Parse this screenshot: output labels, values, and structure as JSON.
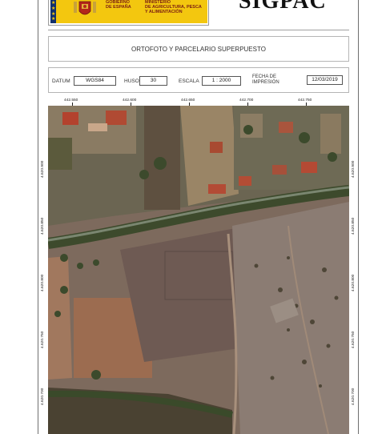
{
  "header": {
    "gov_lines": [
      "GOBIERNO",
      "DE ESPAÑA"
    ],
    "ministry_lines": [
      "MINISTERIO",
      "DE AGRICULTURA, PESCA",
      "Y ALIMENTACIÓN"
    ],
    "app_title": "SIGPAC"
  },
  "map_title": "ORTOFOTO Y PARCELARIO SUPERPUESTO",
  "meta": {
    "datum_label": "DATUM",
    "datum_value": "WGS84",
    "huso_label": "HUSO",
    "huso_value": "30",
    "escala_label": "ESCALA",
    "escala_value": "1 : 2000",
    "fecha_label_1": "FECHA DE",
    "fecha_label_2": "IMPRESIÓN",
    "fecha_value": "12/03/2019"
  },
  "map": {
    "top_ticks": [
      "442.550",
      "442.600",
      "442.650",
      "442.700",
      "442.750"
    ],
    "left_ticks": [
      "4.620.900",
      "4.620.850",
      "4.620.800",
      "4.620.750",
      "4.620.700"
    ],
    "right_ticks": [
      "4.620.900",
      "4.620.850",
      "4.620.800",
      "4.620.750",
      "4.620.700"
    ]
  },
  "colors": {
    "gov_yellow": "#f3c70f",
    "flag_blue": "#12306b",
    "gov_text": "#7a1d12"
  }
}
